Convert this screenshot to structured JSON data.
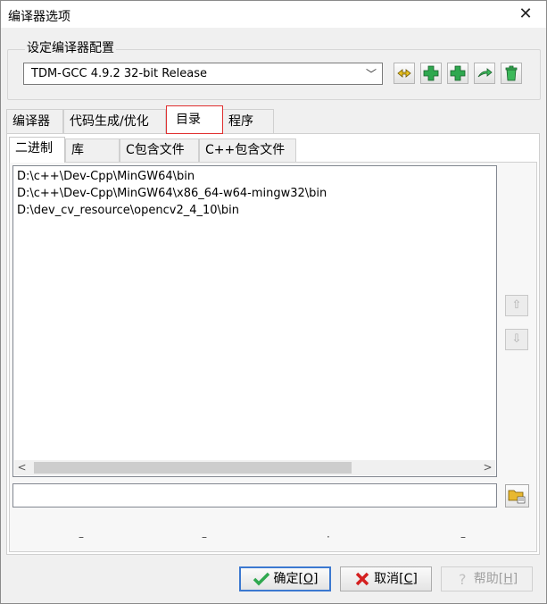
{
  "window": {
    "title": "编译器选项",
    "close_glyph": "✕"
  },
  "config": {
    "group_label": "设定编译器配置",
    "selected": "TDM-GCC 4.9.2 32-bit Release",
    "buttons": [
      "rename-config-icon",
      "add-config-icon",
      "add-config-copy-icon",
      "export-config-icon",
      "delete-config-icon"
    ]
  },
  "tabs": [
    {
      "label": "编译器"
    },
    {
      "label": "代码生成/优化"
    },
    {
      "label": "目录"
    },
    {
      "label": "程序"
    }
  ],
  "subtabs": [
    {
      "label": "二进制"
    },
    {
      "label": "库"
    },
    {
      "label": "C包含文件"
    },
    {
      "label": "C++包含文件"
    }
  ],
  "directories": [
    "D:\\c++\\Dev-Cpp\\MinGW64\\bin",
    "D:\\c++\\Dev-Cpp\\MinGW64\\x86_64-w64-mingw32\\bin",
    "D:\\dev_cv_resource\\opencv2_4_10\\bin"
  ],
  "path_input": {
    "value": ""
  },
  "footer": {
    "ok_label": "确定",
    "ok_hotkey": "[O]",
    "cancel_label": "取消",
    "cancel_hotkey": "[C]",
    "help_label": "帮助",
    "help_hotkey": "[H]"
  },
  "colors": {
    "active_tab_border": "#e03030",
    "default_button_border": "#3b78d0",
    "green_icon": "#2fa84f",
    "red_x": "#d42020"
  }
}
